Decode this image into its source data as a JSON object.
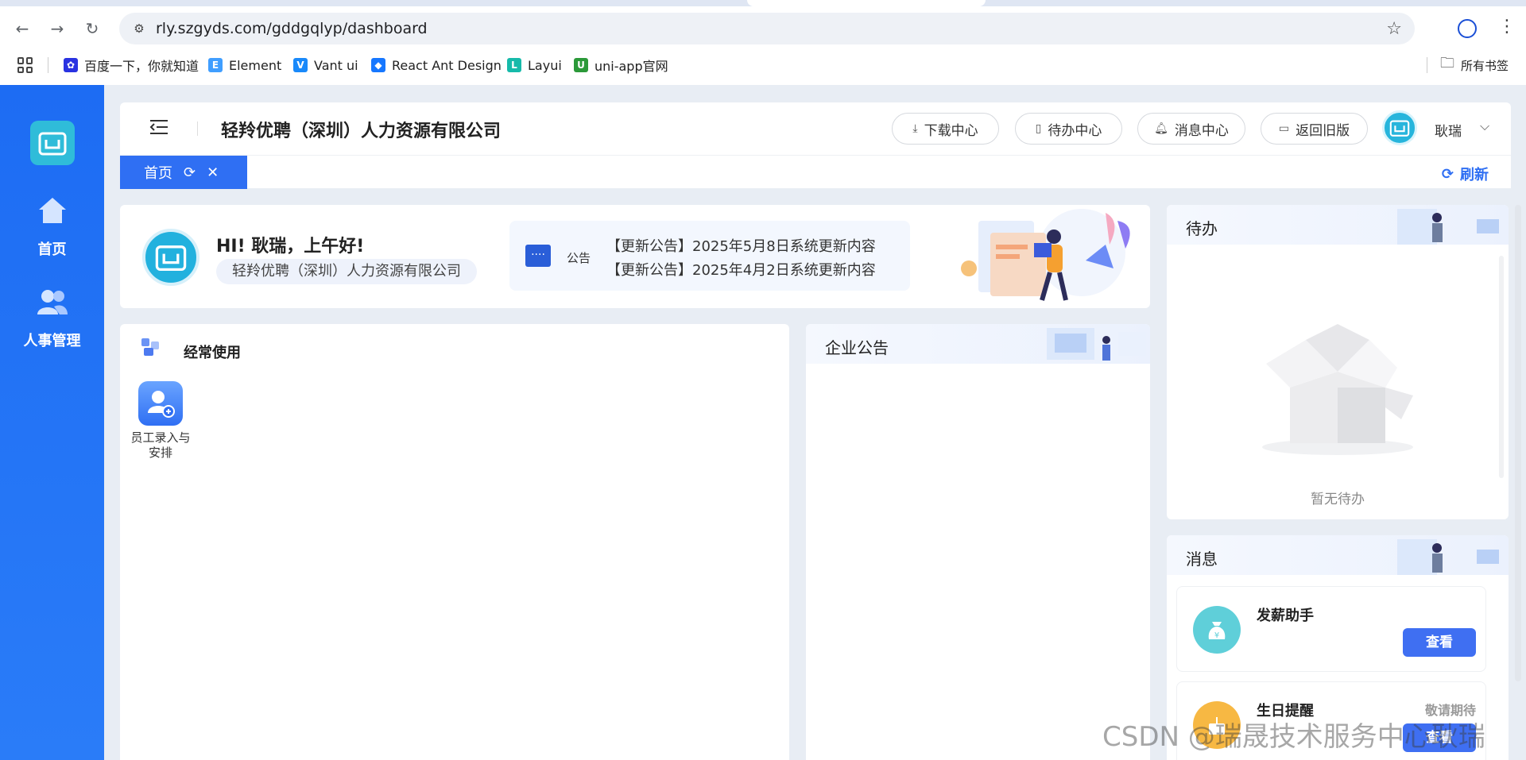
{
  "browser": {
    "url": "rly.szgyds.com/gddgqlyp/dashboard",
    "bookmarks": [
      {
        "label": "百度一下，你就知道",
        "color": "#2932e1",
        "glyph": "✿"
      },
      {
        "label": "Element",
        "color": "#409eff",
        "glyph": "E"
      },
      {
        "label": "Vant ui",
        "color": "#1989fa",
        "glyph": "V"
      },
      {
        "label": "React Ant Design",
        "color": "#1677ff",
        "glyph": "◆"
      },
      {
        "label": "Layui",
        "color": "#16baaa",
        "glyph": "L"
      },
      {
        "label": "uni-app官网",
        "color": "#2b9939",
        "glyph": "U"
      }
    ],
    "all_bookmarks": "所有书签"
  },
  "sidebar": {
    "items": [
      {
        "label": "首页",
        "icon": "home-icon"
      },
      {
        "label": "人事管理",
        "icon": "users-icon"
      }
    ]
  },
  "header": {
    "company": "轻羚优聘（深圳）人力资源有限公司",
    "buttons": [
      {
        "label": "下载中心",
        "icon": "download-icon"
      },
      {
        "label": "待办中心",
        "icon": "todo-icon"
      },
      {
        "label": "消息中心",
        "icon": "bell-icon"
      },
      {
        "label": "返回旧版",
        "icon": "monitor-icon"
      }
    ],
    "user": "耿瑞"
  },
  "tabs": {
    "active": "首页",
    "refresh": "刷新"
  },
  "welcome": {
    "greeting": "HI! 耿瑞，上午好!",
    "company": "轻羚优聘（深圳）人力资源有限公司",
    "notice_label": "公告",
    "notices": [
      "【更新公告】2025年5月8日系统更新内容",
      "【更新公告】2025年4月2日系统更新内容"
    ]
  },
  "frequent": {
    "title": "经常使用",
    "apps": [
      {
        "label_line1": "员工录入与",
        "label_line2": "安排"
      }
    ]
  },
  "enterprise": {
    "title": "企业公告"
  },
  "todo": {
    "title": "待办",
    "empty": "暂无待办"
  },
  "messages": {
    "title": "消息",
    "items": [
      {
        "title": "发薪助手",
        "sub": "",
        "button": "查看",
        "color": "#5fcfd9"
      },
      {
        "title": "生日提醒",
        "sub": "敬请期待",
        "button": "查看",
        "color": "#f7b843"
      }
    ]
  },
  "watermark": "CSDN @瑞晟技术服务中心耿瑞"
}
